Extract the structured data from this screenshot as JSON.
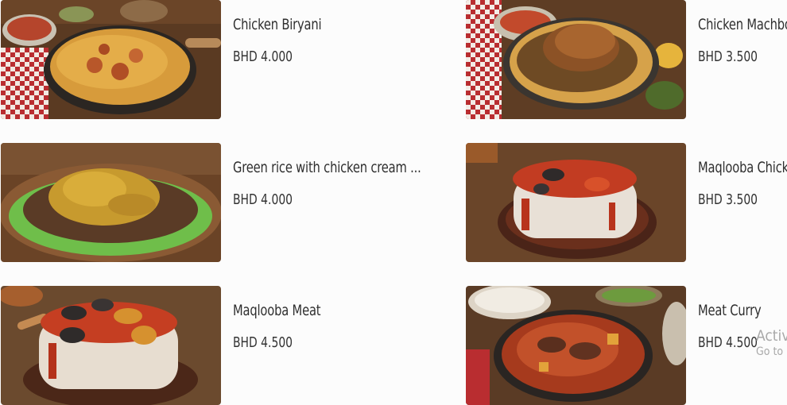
{
  "menu": {
    "items": [
      {
        "name": "Chicken Biryani",
        "price": "BHD 4.000",
        "image": "chicken-biryani-photo"
      },
      {
        "name": "Chicken Machbo",
        "price": "BHD 3.500",
        "image": "chicken-machboos-photo"
      },
      {
        "name": "Green rice with chicken cream ...",
        "price": "BHD 4.000",
        "image": "green-rice-chicken-photo"
      },
      {
        "name": "Maqlooba Chick",
        "price": "BHD 3.500",
        "image": "maqlooba-chicken-photo"
      },
      {
        "name": "Maqlooba Meat",
        "price": "BHD 4.500",
        "image": "maqlooba-meat-photo"
      },
      {
        "name": "Meat Curry",
        "price": "BHD 4.500",
        "image": "meat-curry-photo"
      }
    ]
  },
  "watermark": {
    "line1": "Activ",
    "line2": "Go to"
  }
}
